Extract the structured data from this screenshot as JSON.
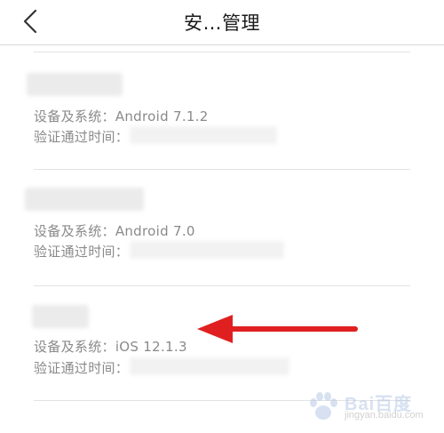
{
  "header": {
    "title": "安…管理",
    "back_icon": "chevron-left-icon"
  },
  "devices": [
    {
      "system_label": "设备及系统：",
      "system_value": "Android 7.1.2",
      "verified_label": "验证通过时间："
    },
    {
      "system_label": "设备及系统：",
      "system_value": "Android 7.0",
      "verified_label": "验证通过时间："
    },
    {
      "system_label": "设备及系统：",
      "system_value": "iOS 12.1.3",
      "verified_label": "验证通过时间："
    }
  ],
  "annotation": {
    "arrow_color": "#e02020"
  },
  "watermark": {
    "brand": "Bai百度",
    "url": "jingyan.baidu.com"
  },
  "colors": {
    "text_secondary": "#8a8a8a",
    "title": "#1a1a1a",
    "divider": "#e3e3e3"
  }
}
